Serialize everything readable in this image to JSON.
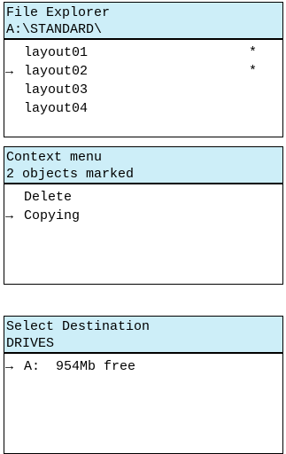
{
  "screens": [
    {
      "header": [
        "File Explorer",
        "A:\\STANDARD\\"
      ],
      "rows": [
        {
          "label": "layout01",
          "marker": "*",
          "selected": false
        },
        {
          "label": "layout02",
          "marker": "*",
          "selected": true
        },
        {
          "label": "layout03",
          "marker": "",
          "selected": false
        },
        {
          "label": "layout04",
          "marker": "",
          "selected": false
        }
      ]
    },
    {
      "header": [
        "Context menu",
        "2 objects marked"
      ],
      "rows": [
        {
          "label": "Delete",
          "marker": "",
          "selected": false
        },
        {
          "label": "Copying",
          "marker": "",
          "selected": true
        }
      ]
    },
    {
      "header": [
        "Select Destination",
        "DRIVES"
      ],
      "rows": [
        {
          "label": "A:  954Mb free",
          "marker": "",
          "selected": true
        }
      ]
    }
  ],
  "icons": {
    "cursor": "right-arrow-icon",
    "cursor_glyph": "→"
  }
}
